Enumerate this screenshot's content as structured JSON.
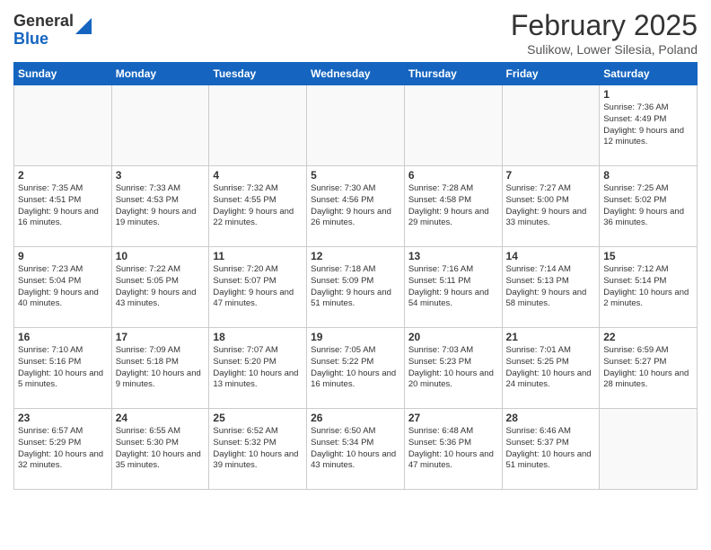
{
  "header": {
    "logo_line1": "General",
    "logo_line2": "Blue",
    "month_title": "February 2025",
    "location": "Sulikow, Lower Silesia, Poland"
  },
  "weekdays": [
    "Sunday",
    "Monday",
    "Tuesday",
    "Wednesday",
    "Thursday",
    "Friday",
    "Saturday"
  ],
  "weeks": [
    [
      {
        "day": "",
        "info": ""
      },
      {
        "day": "",
        "info": ""
      },
      {
        "day": "",
        "info": ""
      },
      {
        "day": "",
        "info": ""
      },
      {
        "day": "",
        "info": ""
      },
      {
        "day": "",
        "info": ""
      },
      {
        "day": "1",
        "info": "Sunrise: 7:36 AM\nSunset: 4:49 PM\nDaylight: 9 hours and 12 minutes."
      }
    ],
    [
      {
        "day": "2",
        "info": "Sunrise: 7:35 AM\nSunset: 4:51 PM\nDaylight: 9 hours and 16 minutes."
      },
      {
        "day": "3",
        "info": "Sunrise: 7:33 AM\nSunset: 4:53 PM\nDaylight: 9 hours and 19 minutes."
      },
      {
        "day": "4",
        "info": "Sunrise: 7:32 AM\nSunset: 4:55 PM\nDaylight: 9 hours and 22 minutes."
      },
      {
        "day": "5",
        "info": "Sunrise: 7:30 AM\nSunset: 4:56 PM\nDaylight: 9 hours and 26 minutes."
      },
      {
        "day": "6",
        "info": "Sunrise: 7:28 AM\nSunset: 4:58 PM\nDaylight: 9 hours and 29 minutes."
      },
      {
        "day": "7",
        "info": "Sunrise: 7:27 AM\nSunset: 5:00 PM\nDaylight: 9 hours and 33 minutes."
      },
      {
        "day": "8",
        "info": "Sunrise: 7:25 AM\nSunset: 5:02 PM\nDaylight: 9 hours and 36 minutes."
      }
    ],
    [
      {
        "day": "9",
        "info": "Sunrise: 7:23 AM\nSunset: 5:04 PM\nDaylight: 9 hours and 40 minutes."
      },
      {
        "day": "10",
        "info": "Sunrise: 7:22 AM\nSunset: 5:05 PM\nDaylight: 9 hours and 43 minutes."
      },
      {
        "day": "11",
        "info": "Sunrise: 7:20 AM\nSunset: 5:07 PM\nDaylight: 9 hours and 47 minutes."
      },
      {
        "day": "12",
        "info": "Sunrise: 7:18 AM\nSunset: 5:09 PM\nDaylight: 9 hours and 51 minutes."
      },
      {
        "day": "13",
        "info": "Sunrise: 7:16 AM\nSunset: 5:11 PM\nDaylight: 9 hours and 54 minutes."
      },
      {
        "day": "14",
        "info": "Sunrise: 7:14 AM\nSunset: 5:13 PM\nDaylight: 9 hours and 58 minutes."
      },
      {
        "day": "15",
        "info": "Sunrise: 7:12 AM\nSunset: 5:14 PM\nDaylight: 10 hours and 2 minutes."
      }
    ],
    [
      {
        "day": "16",
        "info": "Sunrise: 7:10 AM\nSunset: 5:16 PM\nDaylight: 10 hours and 5 minutes."
      },
      {
        "day": "17",
        "info": "Sunrise: 7:09 AM\nSunset: 5:18 PM\nDaylight: 10 hours and 9 minutes."
      },
      {
        "day": "18",
        "info": "Sunrise: 7:07 AM\nSunset: 5:20 PM\nDaylight: 10 hours and 13 minutes."
      },
      {
        "day": "19",
        "info": "Sunrise: 7:05 AM\nSunset: 5:22 PM\nDaylight: 10 hours and 16 minutes."
      },
      {
        "day": "20",
        "info": "Sunrise: 7:03 AM\nSunset: 5:23 PM\nDaylight: 10 hours and 20 minutes."
      },
      {
        "day": "21",
        "info": "Sunrise: 7:01 AM\nSunset: 5:25 PM\nDaylight: 10 hours and 24 minutes."
      },
      {
        "day": "22",
        "info": "Sunrise: 6:59 AM\nSunset: 5:27 PM\nDaylight: 10 hours and 28 minutes."
      }
    ],
    [
      {
        "day": "23",
        "info": "Sunrise: 6:57 AM\nSunset: 5:29 PM\nDaylight: 10 hours and 32 minutes."
      },
      {
        "day": "24",
        "info": "Sunrise: 6:55 AM\nSunset: 5:30 PM\nDaylight: 10 hours and 35 minutes."
      },
      {
        "day": "25",
        "info": "Sunrise: 6:52 AM\nSunset: 5:32 PM\nDaylight: 10 hours and 39 minutes."
      },
      {
        "day": "26",
        "info": "Sunrise: 6:50 AM\nSunset: 5:34 PM\nDaylight: 10 hours and 43 minutes."
      },
      {
        "day": "27",
        "info": "Sunrise: 6:48 AM\nSunset: 5:36 PM\nDaylight: 10 hours and 47 minutes."
      },
      {
        "day": "28",
        "info": "Sunrise: 6:46 AM\nSunset: 5:37 PM\nDaylight: 10 hours and 51 minutes."
      },
      {
        "day": "",
        "info": ""
      }
    ]
  ]
}
